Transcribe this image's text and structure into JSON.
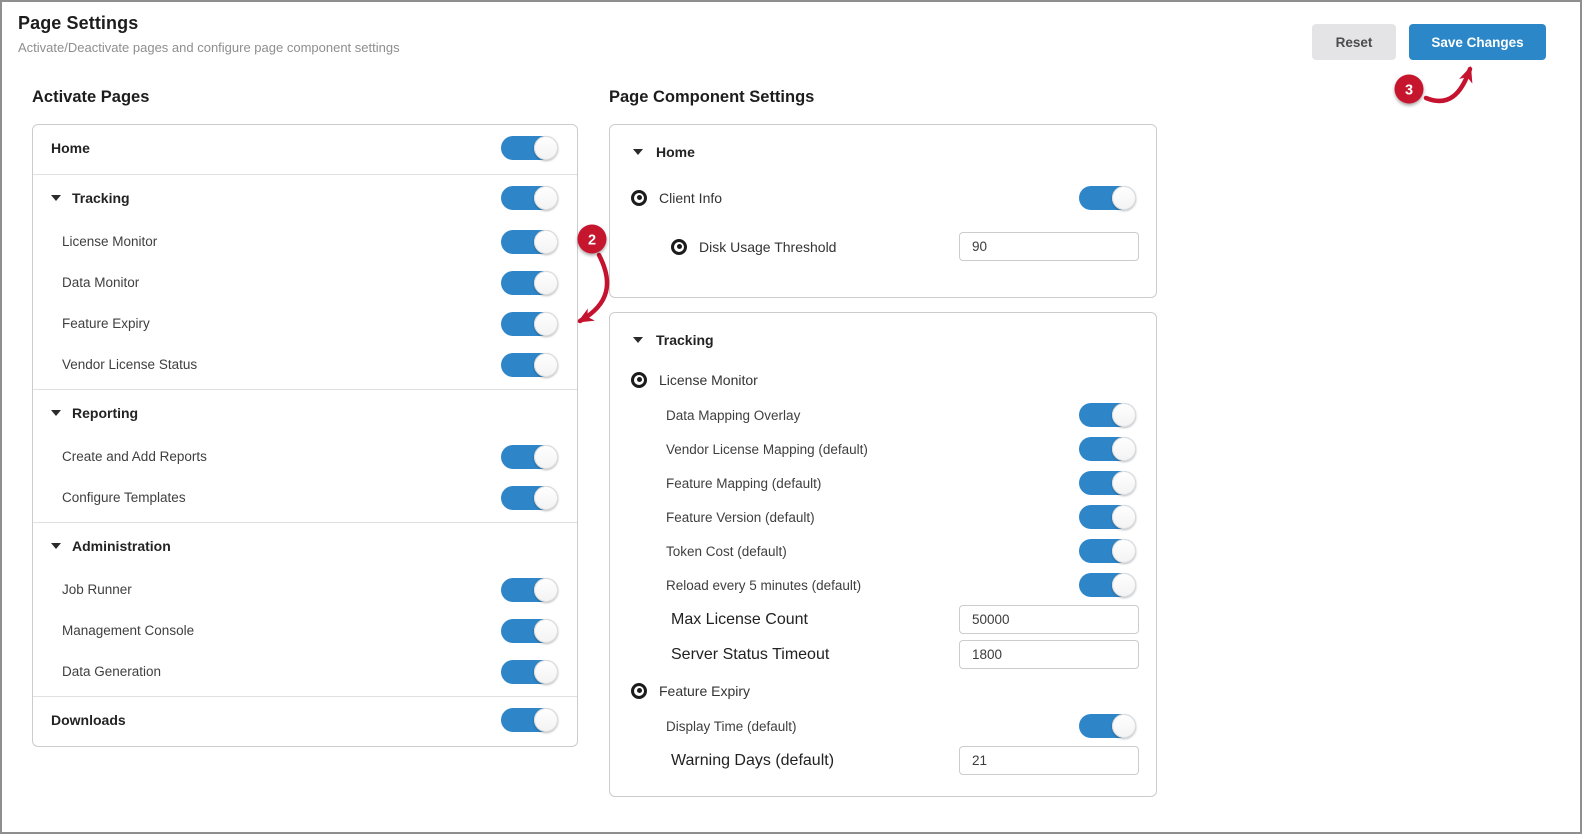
{
  "header": {
    "title": "Page Settings",
    "subtitle": "Activate/Deactivate pages and configure page component settings",
    "reset_label": "Reset",
    "save_label": "Save Changes"
  },
  "activate_pages": {
    "title": "Activate Pages",
    "groups": [
      {
        "rows": [
          {
            "type": "top",
            "label": "Home",
            "toggle": true,
            "on": true
          }
        ]
      },
      {
        "rows": [
          {
            "type": "section",
            "label": "Tracking",
            "toggle": true,
            "on": true
          },
          {
            "type": "child",
            "label": "License Monitor",
            "toggle": true,
            "on": true
          },
          {
            "type": "child",
            "label": "Data Monitor",
            "toggle": true,
            "on": true
          },
          {
            "type": "child",
            "label": "Feature Expiry",
            "toggle": true,
            "on": true
          },
          {
            "type": "child",
            "label": "Vendor License Status",
            "toggle": true,
            "on": true
          }
        ]
      },
      {
        "rows": [
          {
            "type": "section",
            "label": "Reporting",
            "toggle": false
          },
          {
            "type": "child",
            "label": "Create and Add Reports",
            "toggle": true,
            "on": true
          },
          {
            "type": "child",
            "label": "Configure Templates",
            "toggle": true,
            "on": true
          }
        ]
      },
      {
        "rows": [
          {
            "type": "section",
            "label": "Administration",
            "toggle": false
          },
          {
            "type": "child",
            "label": "Job Runner",
            "toggle": true,
            "on": true
          },
          {
            "type": "child",
            "label": "Management Console",
            "toggle": true,
            "on": true
          },
          {
            "type": "child",
            "label": "Data Generation",
            "toggle": true,
            "on": true
          }
        ]
      },
      {
        "rows": [
          {
            "type": "top",
            "label": "Downloads",
            "toggle": true,
            "on": true
          }
        ]
      }
    ]
  },
  "page_component_settings": {
    "title": "Page Component Settings",
    "cards": [
      {
        "header": "Home",
        "rows": [
          {
            "type": "bullseye",
            "label": "Client Info",
            "control": "toggle",
            "on": true
          },
          {
            "type": "bullseye",
            "label": "Disk Usage Threshold",
            "control": "input",
            "value": "90"
          }
        ]
      },
      {
        "header": "Tracking",
        "rows": [
          {
            "type": "bullseye",
            "label": "License Monitor"
          },
          {
            "type": "child",
            "label": "Data Mapping Overlay",
            "control": "toggle",
            "on": true
          },
          {
            "type": "child",
            "label": "Vendor License Mapping (default)",
            "control": "toggle",
            "on": true
          },
          {
            "type": "child",
            "label": "Feature Mapping (default)",
            "control": "toggle",
            "on": true
          },
          {
            "type": "child",
            "label": "Feature Version (default)",
            "control": "toggle",
            "on": true
          },
          {
            "type": "child",
            "label": "Token Cost (default)",
            "control": "toggle",
            "on": true
          },
          {
            "type": "child",
            "label": "Reload every 5 minutes (default)",
            "control": "toggle",
            "on": true
          },
          {
            "type": "child",
            "label": "Max License Count",
            "control": "input",
            "value": "50000"
          },
          {
            "type": "child",
            "label": "Server Status Timeout",
            "control": "input",
            "value": "1800"
          },
          {
            "type": "bullseye",
            "label": "Feature Expiry"
          },
          {
            "type": "child",
            "label": "Display Time (default)",
            "control": "toggle",
            "on": true
          },
          {
            "type": "child",
            "label": "Warning Days (default)",
            "control": "input",
            "value": "21"
          }
        ]
      }
    ]
  },
  "annotations": {
    "step2_label": "2",
    "step3_label": "3"
  },
  "colors": {
    "toggle_blue": "#2e86c8",
    "save_button_blue": "#2b87c8",
    "annotation_red": "#c5122f"
  }
}
